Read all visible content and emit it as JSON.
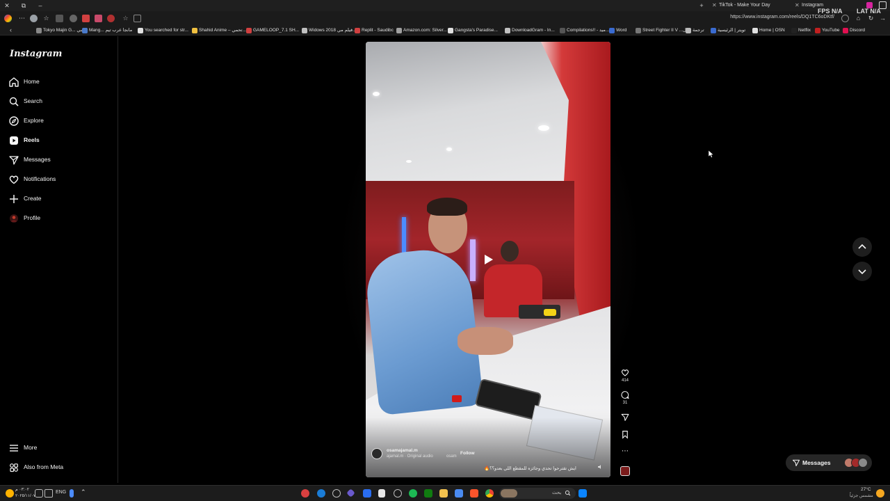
{
  "browser": {
    "tabs": [
      {
        "label": "TikTok - Make Your Day"
      },
      {
        "label": "Instagram"
      }
    ],
    "fps_label": "FPS",
    "fps_value": "N/A",
    "lat_label": "LAT",
    "lat_value": "N/A",
    "url": "https://www.instagram.com/reels/DQ1TC6oDKtf/",
    "bookmarks": [
      {
        "label": "Tokyo Majin G... السي",
        "color": "#888888"
      },
      {
        "label": "Mang... مانجا عرب تيم",
        "color": "#4a7ac9"
      },
      {
        "label": "You searched for str...",
        "color": "#e0e0e0"
      },
      {
        "label": "Shahid Anime – تحمي...",
        "color": "#f0c040"
      },
      {
        "label": "GAMELOOP_7.1 SH...",
        "color": "#d04040"
      },
      {
        "label": "Widows 2018 فيلم مي...",
        "color": "#c0c0c0"
      },
      {
        "label": "Replit - Saudibc",
        "color": "#d04040"
      },
      {
        "label": "Amazon.com: Silver...",
        "color": "#a0a0a0"
      },
      {
        "label": "Gangsta's Paradise...",
        "color": "#e0e0e0"
      },
      {
        "label": "DownloadGram - In...",
        "color": "#c0c0c0"
      },
      {
        "label": "Compilations!! - ميد...",
        "color": "#555555"
      },
      {
        "label": "Word",
        "color": "#3a6bd0"
      },
      {
        "label": "Street Fighter II V ...ال",
        "color": "#777777"
      },
      {
        "label": "ترجمة",
        "color": "#bbbbbb"
      },
      {
        "label": "تويتر | الرئيسية",
        "color": "#3a6bd0"
      },
      {
        "label": "Home | OSN",
        "color": "#e0e0e0"
      },
      {
        "label": "Netflix",
        "color": "#222222"
      },
      {
        "label": "YouTube",
        "color": "#c02020"
      },
      {
        "label": "Discord",
        "color": "#e01050"
      }
    ]
  },
  "sidebar": {
    "logo": "Instagram",
    "items": [
      {
        "label": "Home",
        "icon": "home-icon"
      },
      {
        "label": "Search",
        "icon": "search-icon"
      },
      {
        "label": "Explore",
        "icon": "compass-icon"
      },
      {
        "label": "Reels",
        "icon": "reels-icon"
      },
      {
        "label": "Messages",
        "icon": "paper-plane-icon"
      },
      {
        "label": "Notifications",
        "icon": "heart-icon"
      },
      {
        "label": "Create",
        "icon": "plus-icon"
      },
      {
        "label": "Profile",
        "icon": "avatar-icon"
      }
    ],
    "bottom": [
      {
        "label": "More",
        "icon": "menu-icon"
      },
      {
        "label": "Also from Meta",
        "icon": "meta-icon"
      }
    ]
  },
  "reel": {
    "likes": "414",
    "comments": "31",
    "username": "osamajamal.m",
    "follow_label": "Follow",
    "audio": "ajamal.m · Original audio",
    "audio_extra": "osam",
    "caption": "ايش تقترحوا تحدي وجائزه للمقطع اللي بعدو؟؟🔥"
  },
  "messages_pill": {
    "label": "Messages"
  },
  "taskbar": {
    "lang": "ENG",
    "time": "٠٣:٠٢ م",
    "date": "٢٠٢٥/١١/٠٧",
    "search_placeholder": "بحث",
    "weather_temp": "27°C",
    "weather_desc": "مشمس جزئياً"
  },
  "colors": {
    "accent": "#0095f6",
    "panel": "#262626"
  }
}
